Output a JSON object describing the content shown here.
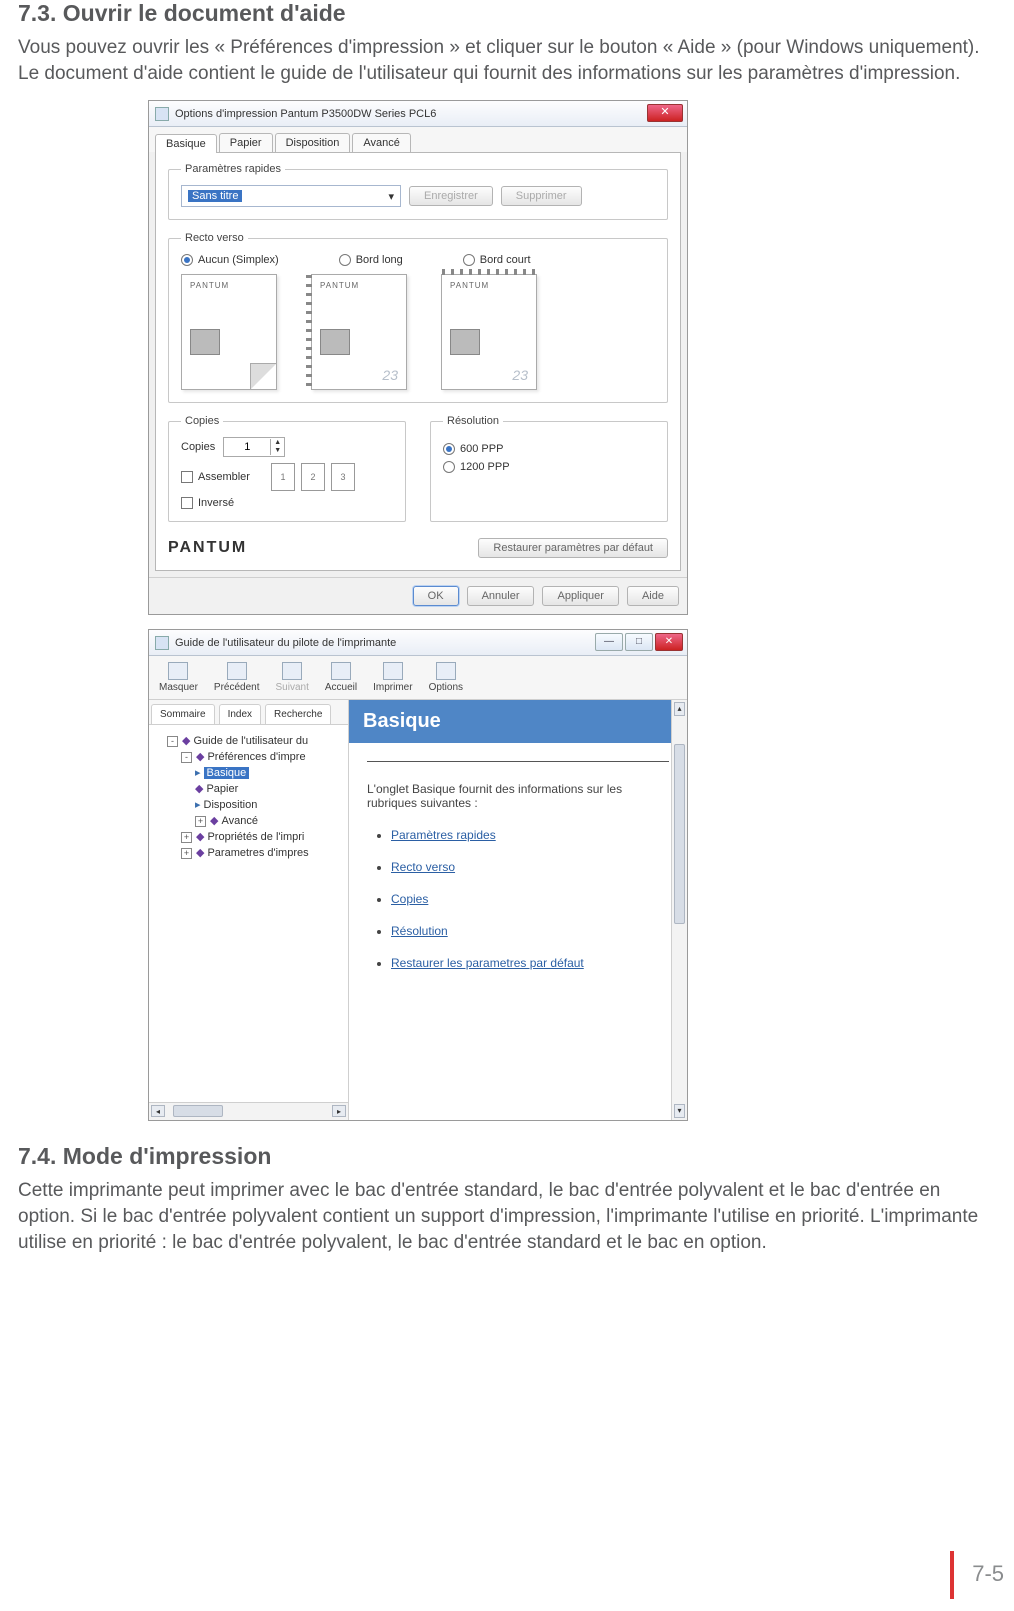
{
  "section73": {
    "heading": "7.3. Ouvrir le document d'aide",
    "para": "Vous pouvez ouvrir les « Préférences d'impression » et cliquer sur le bouton « Aide » (pour Windows uniquement). Le document d'aide contient le guide de l'utilisateur qui fournit des informations sur les paramètres d'impression."
  },
  "dlg1": {
    "title": "Options d'impression Pantum P3500DW Series PCL6",
    "tabs": {
      "basique": "Basique",
      "papier": "Papier",
      "disposition": "Disposition",
      "avance": "Avancé"
    },
    "group_quick": {
      "legend": "Paramètres rapides",
      "selected": "Sans titre",
      "save": "Enregistrer",
      "delete": "Supprimer"
    },
    "group_duplex": {
      "legend": "Recto verso",
      "opt_none": "Aucun (Simplex)",
      "opt_long": "Bord long",
      "opt_short": "Bord court"
    },
    "group_copies": {
      "legend": "Copies",
      "label": "Copies",
      "value": "1",
      "assemble": "Assembler",
      "inverse": "Inversé"
    },
    "group_res": {
      "legend": "Résolution",
      "r600": "600 PPP",
      "r1200": "1200 PPP"
    },
    "brand": "PANTUM",
    "restore": "Restaurer paramètres par défaut",
    "footer": {
      "ok": "OK",
      "cancel": "Annuler",
      "apply": "Appliquer",
      "help": "Aide"
    }
  },
  "dlg2": {
    "title": "Guide de l'utilisateur du pilote de l'imprimante",
    "toolbar": {
      "hide": "Masquer",
      "back": "Précédent",
      "fwd": "Suivant",
      "home": "Accueil",
      "print": "Imprimer",
      "options": "Options"
    },
    "navTabs": {
      "summary": "Sommaire",
      "index": "Index",
      "search": "Recherche"
    },
    "tree": {
      "root": "Guide de l'utilisateur du",
      "prefs": "Préférences d'impre",
      "basique": "Basique",
      "papier": "Papier",
      "dispo": "Disposition",
      "avance": "Avancé",
      "props": "Propriétés de l'impri",
      "params": "Parametres d'impres"
    },
    "content": {
      "header": "Basique",
      "intro": "L'onglet Basique fournit des informations sur les rubriques suivantes :",
      "links": {
        "quick": "Paramètres rapides",
        "duplex": "Recto verso",
        "copies": "Copies",
        "res": "Résolution",
        "restore": "Restaurer les parametres par défaut"
      }
    }
  },
  "section74": {
    "heading": "7.4. Mode d'impression",
    "para": "Cette imprimante peut imprimer avec le bac d'entrée standard, le bac d'entrée polyvalent et le bac d'entrée en option. Si le bac d'entrée polyvalent contient un support d'impression, l'imprimante l'utilise en priorité. L'imprimante utilise en priorité : le bac d'entrée polyvalent, le bac d'entrée standard et le bac en option."
  },
  "pageNumber": "7-5"
}
